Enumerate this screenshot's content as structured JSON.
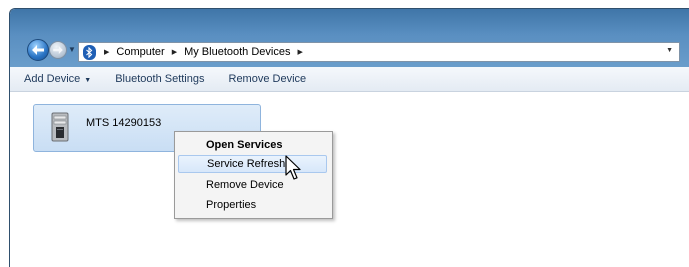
{
  "window": {
    "address": {
      "crumbs": [
        "Computer",
        "My Bluetooth Devices"
      ]
    }
  },
  "toolbar": {
    "add_device": "Add Device",
    "bluetooth_settings": "Bluetooth Settings",
    "remove_device": "Remove Device"
  },
  "device": {
    "name": "MTS 14290153",
    "icon": "pc-tower-icon"
  },
  "context_menu": {
    "items": [
      {
        "label": "Open Services",
        "bold": true
      },
      {
        "label": "Service Refresh",
        "highlighted": true
      },
      {
        "label": "Remove Device"
      },
      {
        "label": "Properties"
      }
    ]
  },
  "colors": {
    "titlebar": "#5a8fc1",
    "bluetooth_icon": "#1f5fb5",
    "tile_selected": "#c9def4",
    "menu_highlight": "#d7e7fa"
  }
}
